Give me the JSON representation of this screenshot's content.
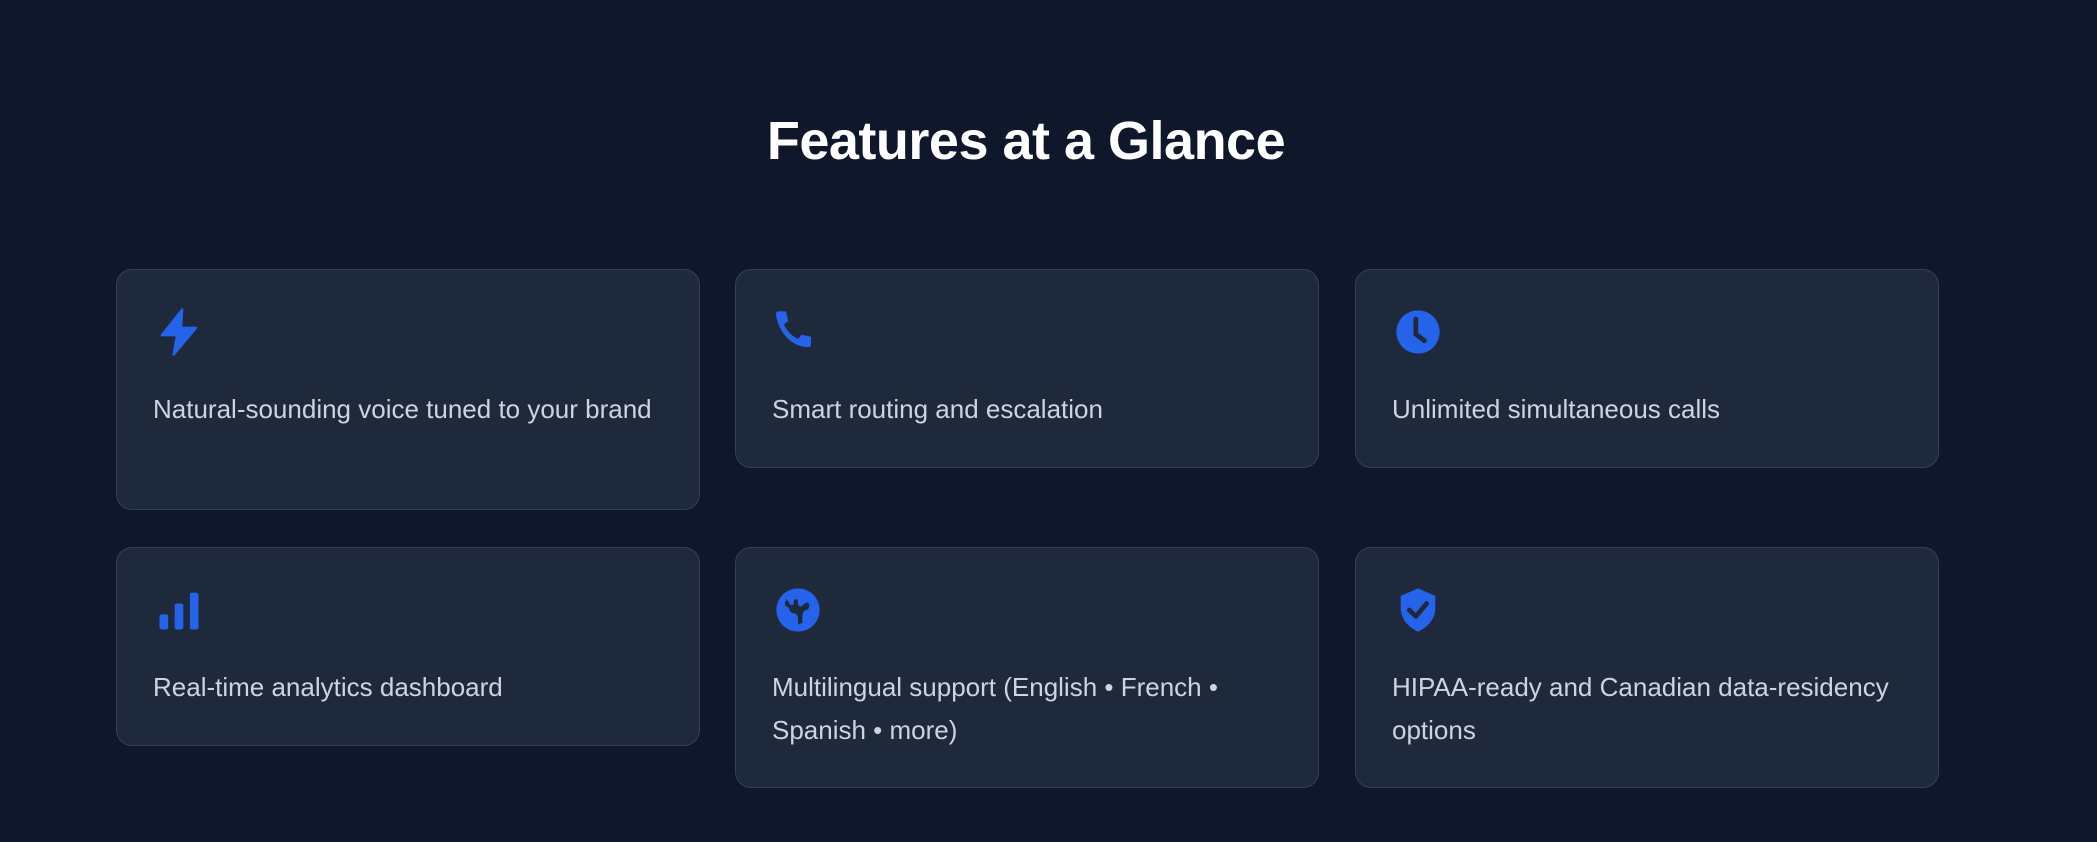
{
  "section": {
    "title": "Features at a Glance"
  },
  "features": [
    {
      "icon": "lightning-icon",
      "text": "Natural-sounding voice tuned to your brand"
    },
    {
      "icon": "phone-icon",
      "text": "Smart routing and escalation"
    },
    {
      "icon": "clock-icon",
      "text": "Unlimited simultaneous calls"
    },
    {
      "icon": "bar-chart-icon",
      "text": "Real-time analytics dashboard"
    },
    {
      "icon": "globe-icon",
      "text": "Multilingual support (English • French • Spanish • more)"
    },
    {
      "icon": "shield-check-icon",
      "text": "HIPAA-ready and Canadian data-residency options"
    }
  ],
  "colors": {
    "background": "#0f172a",
    "card": "#1e293b",
    "accent": "#2563eb",
    "text": "#cbd5e1"
  }
}
